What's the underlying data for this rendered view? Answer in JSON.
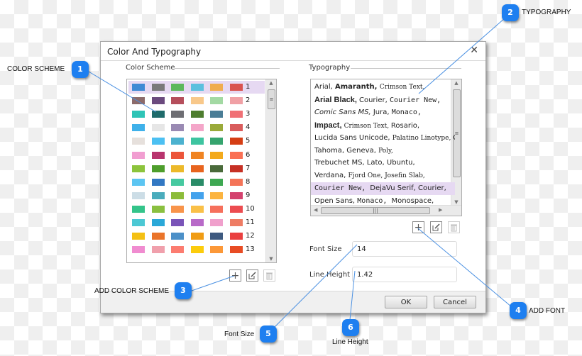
{
  "dialog": {
    "title": "Color And Typography",
    "close_icon": "close-icon",
    "color_scheme": {
      "label": "Color Scheme",
      "selected_row": 1,
      "rows": [
        {
          "num": "1",
          "colors": [
            "#3f8ad4",
            "#7a7a7a",
            "#5cb85c",
            "#5bc0de",
            "#f0ad4e",
            "#d9534f"
          ]
        },
        {
          "num": "2",
          "colors": [
            "#8c6b6b",
            "#6b4a7e",
            "#b54e5b",
            "#f8c88a",
            "#a3d9a3",
            "#f0a0a5"
          ]
        },
        {
          "num": "3",
          "colors": [
            "#2ec4b6",
            "#1f6b6b",
            "#6e6e73",
            "#4e7d2f",
            "#4a7d96",
            "#f07075"
          ]
        },
        {
          "num": "4",
          "colors": [
            "#3fb1ea",
            "#e6e6e6",
            "#9a8ab3",
            "#f4a6c9",
            "#9aaa3a",
            "#d95c5c"
          ]
        },
        {
          "num": "5",
          "colors": [
            "#e6e0dc",
            "#4cc0f2",
            "#4cb2cf",
            "#3ec4a0",
            "#36a46e",
            "#d53e14"
          ]
        },
        {
          "num": "6",
          "colors": [
            "#f19ed1",
            "#b8346e",
            "#ec553a",
            "#f08422",
            "#f3aa1c",
            "#fa7054"
          ]
        },
        {
          "num": "7",
          "colors": [
            "#8cc43c",
            "#4e9e2c",
            "#ecb92a",
            "#e8641e",
            "#4a6a3a",
            "#c63024"
          ]
        },
        {
          "num": "8",
          "colors": [
            "#5cc5f2",
            "#3278c3",
            "#46c9a0",
            "#2a8c68",
            "#3ea852",
            "#f47458"
          ]
        },
        {
          "num": "9",
          "colors": [
            "#ccdde6",
            "#4aacbc",
            "#8cbc3a",
            "#44a2ec",
            "#fcb440",
            "#d4426e"
          ]
        },
        {
          "num": "10",
          "colors": [
            "#34c48a",
            "#8ac040",
            "#f8944a",
            "#fac048",
            "#f6705c",
            "#ec4c50"
          ]
        },
        {
          "num": "11",
          "colors": [
            "#4cc8d4",
            "#2aa8d8",
            "#7a54b8",
            "#b86ac8",
            "#f0a0cc",
            "#ee7c64"
          ]
        },
        {
          "num": "12",
          "colors": [
            "#f4c014",
            "#ea742a",
            "#4c90c8",
            "#f09c14",
            "#3e5a80",
            "#ea4040"
          ]
        },
        {
          "num": "13",
          "colors": [
            "#f08cd0",
            "#f0a0ac",
            "#fc7c70",
            "#fccc0c",
            "#fc9838",
            "#e84c24"
          ]
        }
      ]
    },
    "typography": {
      "label": "Typography",
      "selected_index": 8,
      "fonts": [
        [
          {
            "t": "Arial,",
            "f": "sans"
          },
          {
            "t": "Amaranth,",
            "f": "bold"
          },
          {
            "t": "Crimson Text,",
            "f": "serif"
          }
        ],
        [
          {
            "t": "Arial Black,",
            "f": "black"
          },
          {
            "t": "Courier,",
            "f": "sans"
          },
          {
            "t": "Courier New,",
            "f": "mono"
          }
        ],
        [
          {
            "t": "Comic Sans MS,",
            "f": "italic"
          },
          {
            "t": "Jura,",
            "f": "sans"
          },
          {
            "t": "Monaco,",
            "f": "mono"
          }
        ],
        [
          {
            "t": "Impact,",
            "f": "black"
          },
          {
            "t": "Crimson Text,",
            "f": "serif"
          },
          {
            "t": "Rosario,",
            "f": "sans"
          }
        ],
        [
          {
            "t": "Lucida Sans Unicode,",
            "f": "sans"
          },
          {
            "t": "Palatino Linotype,",
            "f": "serif"
          },
          {
            "t": "C",
            "f": "sans"
          }
        ],
        [
          {
            "t": "Tahoma,",
            "f": "sans"
          },
          {
            "t": "Geneva,",
            "f": "sans"
          },
          {
            "t": "Poly,",
            "f": "serif"
          }
        ],
        [
          {
            "t": "Trebuchet MS,",
            "f": "sans"
          },
          {
            "t": "Lato,",
            "f": "sans"
          },
          {
            "t": "Ubuntu,",
            "f": "sans"
          }
        ],
        [
          {
            "t": "Verdana,",
            "f": "sans"
          },
          {
            "t": "Fjord One,",
            "f": "serif"
          },
          {
            "t": "Josefin Slab,",
            "f": "serif"
          }
        ],
        [
          {
            "t": "Courier New,",
            "f": "mono"
          },
          {
            "t": "DejaVu Serif,",
            "f": "sans"
          },
          {
            "t": "Courier,",
            "f": "sans"
          }
        ],
        [
          {
            "t": "Open Sans,",
            "f": "sans"
          },
          {
            "t": "Monaco,",
            "f": "mono"
          },
          {
            "t": "Monospace,",
            "f": "sans"
          }
        ]
      ]
    },
    "font_size": {
      "label": "Font Size",
      "value": "14"
    },
    "line_height": {
      "label": "Line Height",
      "value": "1.42"
    },
    "buttons": {
      "ok": "OK",
      "cancel": "Cancel"
    },
    "scheme_actions": [
      "add-icon",
      "edit-icon",
      "delete-icon"
    ],
    "font_actions": [
      "add-icon",
      "edit-icon",
      "delete-icon"
    ]
  },
  "callouts": [
    {
      "num": "1",
      "label": "COLOR SCHEME"
    },
    {
      "num": "2",
      "label": "TYPOGRAPHY"
    },
    {
      "num": "3",
      "label": "ADD COLOR SCHEME"
    },
    {
      "num": "4",
      "label": "ADD FONT"
    },
    {
      "num": "5",
      "label": "Font Size"
    },
    {
      "num": "6",
      "label": "Line Height"
    }
  ],
  "colors": {
    "accent": "#1e7ff0",
    "selection": "#e6d9f2"
  }
}
